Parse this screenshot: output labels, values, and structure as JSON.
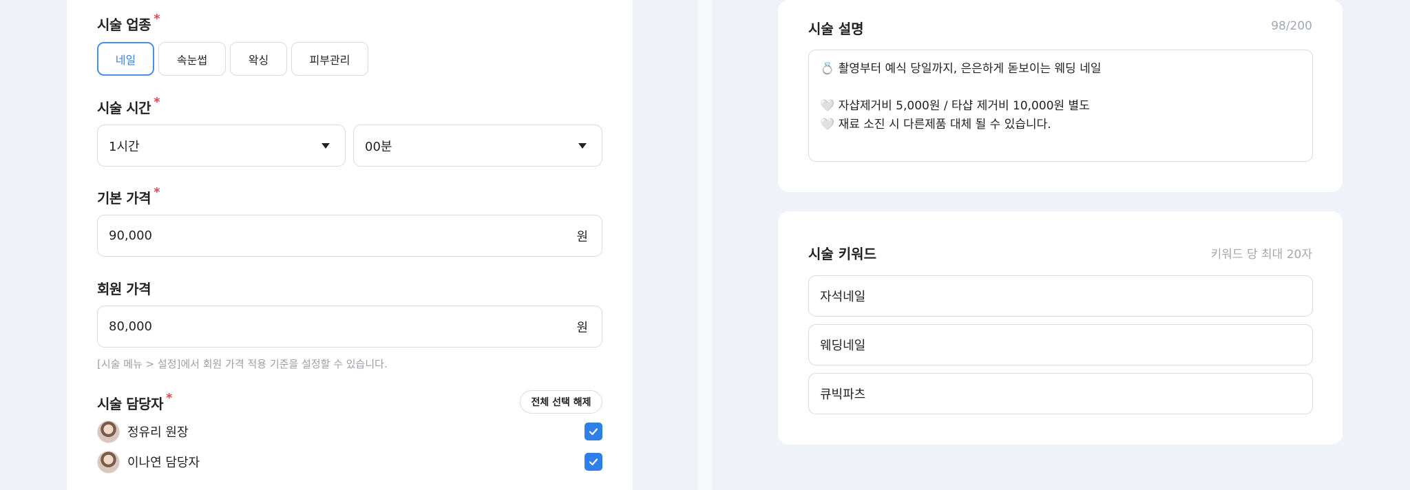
{
  "form": {
    "category": {
      "label": "시술 업종",
      "required_mark": "*",
      "options": [
        "네일",
        "속눈썹",
        "왁싱",
        "피부관리"
      ],
      "selected": "네일"
    },
    "duration": {
      "label": "시술 시간",
      "required_mark": "*",
      "hours": "1시간",
      "minutes": "00분"
    },
    "base_price": {
      "label": "기본 가격",
      "required_mark": "*",
      "value": "90,000",
      "unit": "원"
    },
    "member_price": {
      "label": "회원 가격",
      "value": "80,000",
      "unit": "원",
      "hint": "[시술 메뉴 > 설정]에서 회원 가격 적용 기준을 설정할 수 있습니다."
    },
    "staff": {
      "label": "시술 담당자",
      "required_mark": "*",
      "deselect_all": "전체 선택 해제",
      "members": [
        {
          "name": "정유리 원장",
          "checked": true
        },
        {
          "name": "이나연 담당자",
          "checked": true
        }
      ]
    }
  },
  "description": {
    "title": "시술 설명",
    "counter": "98/200",
    "lines": [
      "💍 촬영부터 예식 당일까지, 은은하게 돋보이는 웨딩 네일",
      "",
      "🤍 자샵제거비 5,000원 / 타샵 제거비 10,000원 별도",
      "🤍 재료 소진 시 다른제품 대체 될 수 있습니다."
    ]
  },
  "keywords": {
    "title": "시술 키워드",
    "limit_hint": "키워드 당 최대 20자",
    "items": [
      "자석네일",
      "웨딩네일",
      "큐빅파츠"
    ]
  },
  "colors": {
    "accent": "#2f7fe6",
    "required": "#e5484d",
    "background": "#eff2f8"
  }
}
